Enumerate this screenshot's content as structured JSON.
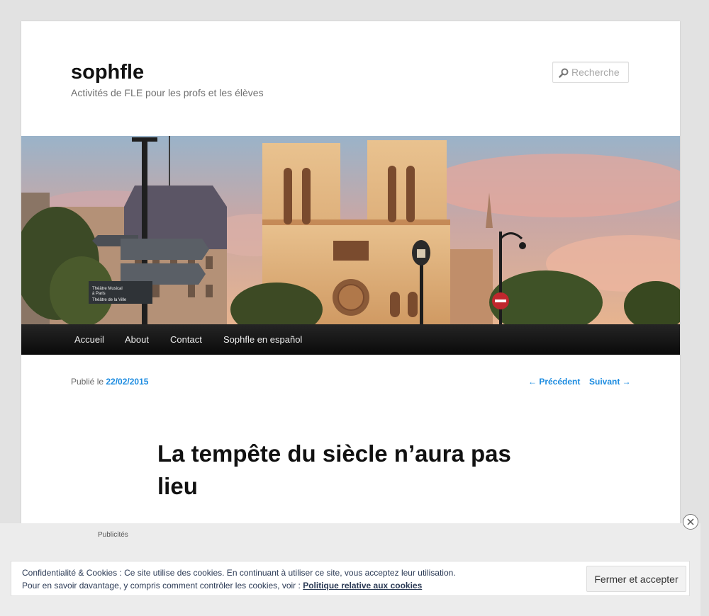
{
  "site": {
    "title": "sophfle",
    "tagline": "Activités de FLE pour les profs et les élèves"
  },
  "search": {
    "placeholder": "Recherche",
    "icon": "search-icon"
  },
  "banner": {
    "sign_text_1": "Théâtre Musical",
    "sign_text_2": "à Paris",
    "sign_text_3": "Théâtre de la Ville"
  },
  "nav": {
    "items": [
      {
        "label": "Accueil"
      },
      {
        "label": "About"
      },
      {
        "label": "Contact"
      },
      {
        "label": "Sophfle en español"
      }
    ]
  },
  "post": {
    "published_prefix": "Publié le",
    "date": "22/02/2015",
    "previous_label": "← Précédent",
    "next_label": "Suivant →",
    "title": "La tempête du siècle n’aura pas lieu"
  },
  "ads": {
    "label": "Publicités",
    "close_icon": "close-icon"
  },
  "cookie": {
    "line1": "Confidentialité & Cookies : Ce site utilise des cookies. En continuant à utiliser ce site, vous acceptez leur utilisation.",
    "line2_prefix": "Pour en savoir davantage, y compris comment contrôler les cookies, voir :",
    "policy_link": "Politique relative aux cookies",
    "accept_button": "Fermer et accepter"
  },
  "colors": {
    "link_blue": "#1b8be0",
    "nav_bg": "#1a1a1a",
    "page_bg": "#e2e2e2"
  }
}
